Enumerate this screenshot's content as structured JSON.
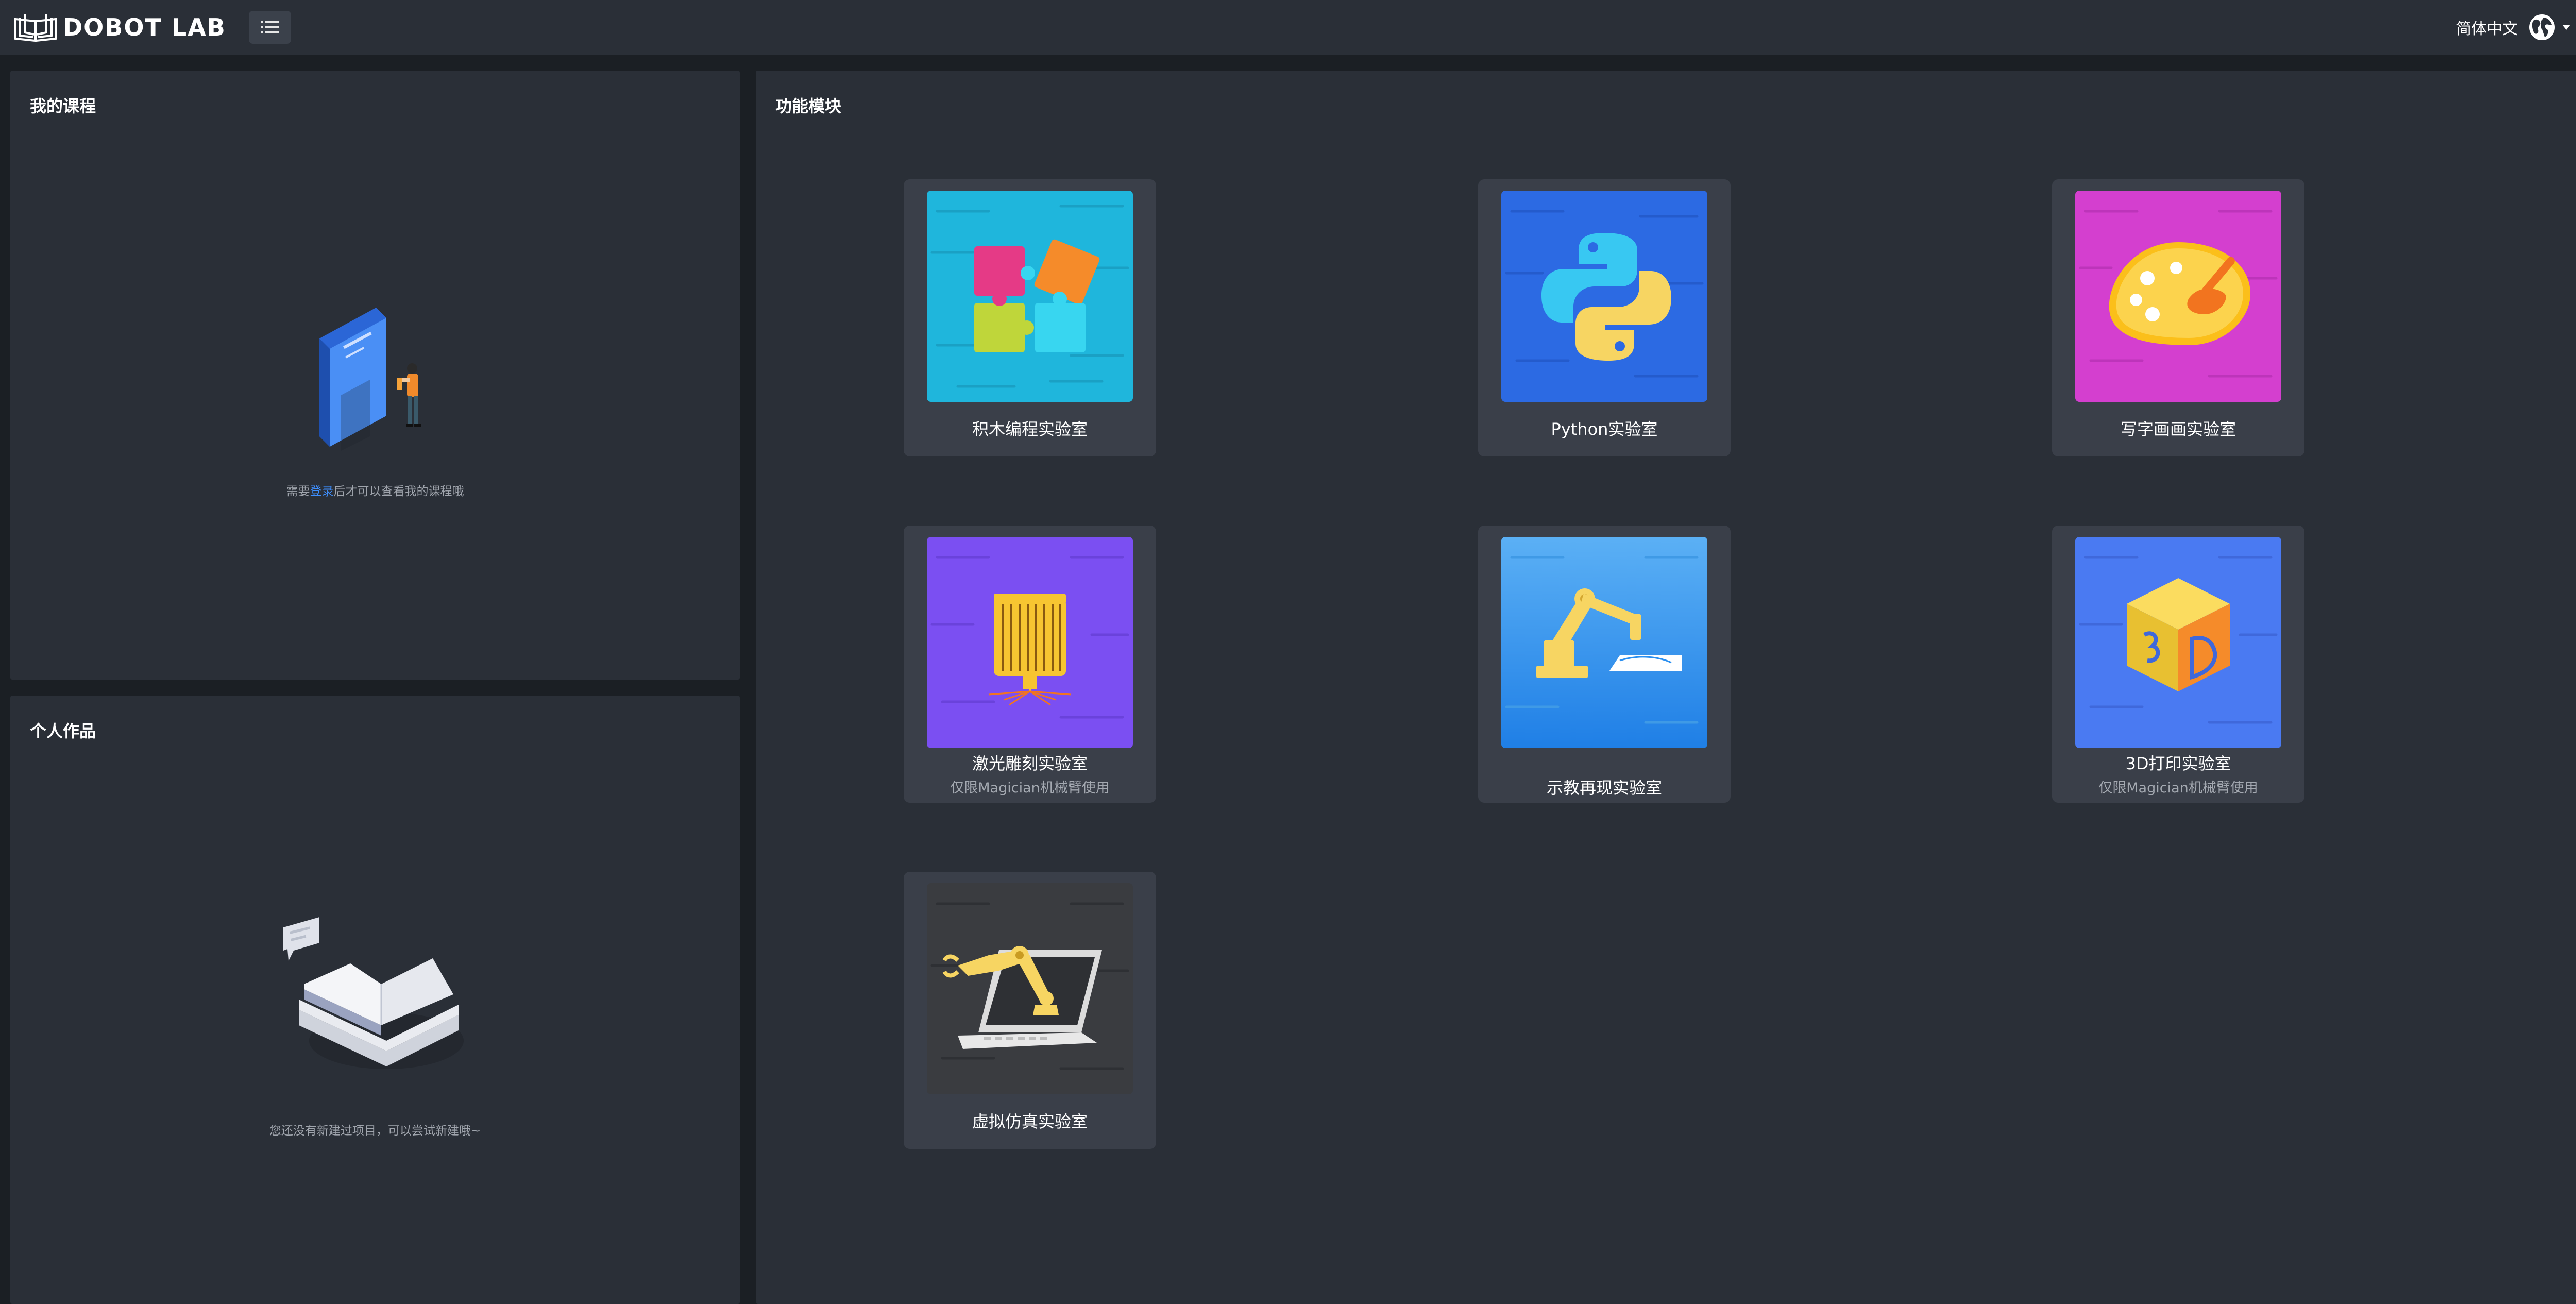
{
  "header": {
    "brand": "DOBOT LAB",
    "language": "简体中文",
    "login": "登录"
  },
  "courses": {
    "title": "我的课程",
    "hint_pre": "需要",
    "hint_link": "登录",
    "hint_post": "后才可以查看我的课程哦"
  },
  "works": {
    "title": "个人作品",
    "hint": "您还没有新建过项目，可以尝试新建哦~"
  },
  "modules": {
    "title": "功能模块",
    "cards": [
      {
        "title": "积木编程实验室",
        "subtitle": "",
        "icon": "puzzle-icon",
        "color": "#22b8e0"
      },
      {
        "title": "Python实验室",
        "subtitle": "",
        "icon": "python-icon",
        "color": "#2f6fe6"
      },
      {
        "title": "写字画画实验室",
        "subtitle": "",
        "icon": "palette-icon",
        "color": "#d43fcf"
      },
      {
        "title": "激光雕刻实验室",
        "subtitle": "仅限Magician机械臂使用",
        "icon": "laser-icon",
        "color": "#7a4ff0"
      },
      {
        "title": "示教再现实验室",
        "subtitle": "",
        "icon": "robot-arm-icon",
        "color": "#2a8ff0"
      },
      {
        "title": "3D打印实验室",
        "subtitle": "仅限Magician机械臂使用",
        "icon": "3d-cube-icon",
        "color": "#4a78f0"
      },
      {
        "title": "虚拟仿真实验室",
        "subtitle": "",
        "icon": "laptop-arm-icon",
        "color": "#3b3d40"
      }
    ]
  }
}
